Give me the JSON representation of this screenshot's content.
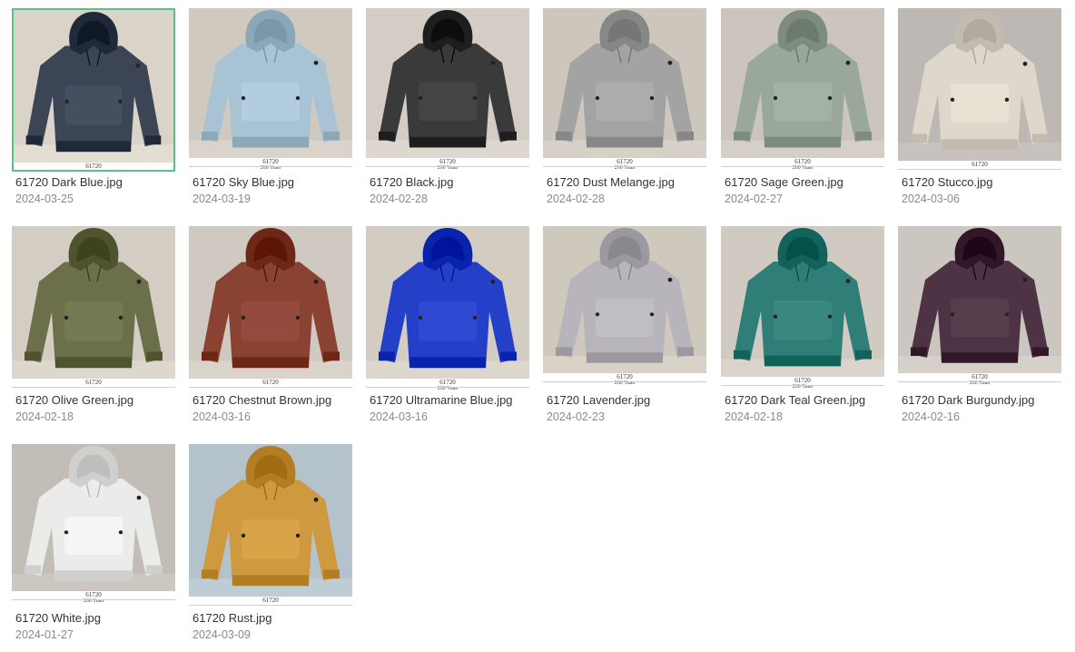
{
  "files": [
    {
      "name": "61720 Dark Blue.jpg",
      "date": "2024-03-25",
      "code": "61720",
      "price": "",
      "color": "#3b4556",
      "bg": "#d9d3c8",
      "selected": true
    },
    {
      "name": "61720 Sky Blue.jpg",
      "date": "2024-03-19",
      "code": "61720",
      "price": "260 Yuan",
      "color": "#a8c3d4",
      "bg": "#cfc9c0",
      "selected": false
    },
    {
      "name": "61720 Black.jpg",
      "date": "2024-02-28",
      "code": "61720",
      "price": "260 Yuan",
      "color": "#3a3a3b",
      "bg": "#d3cdc5",
      "selected": false
    },
    {
      "name": "61720 Dust Melange.jpg",
      "date": "2024-02-28",
      "code": "61720",
      "price": "260 Yuan",
      "color": "#a2a3a2",
      "bg": "#cdc6bd",
      "selected": false
    },
    {
      "name": "61720 Sage Green.jpg",
      "date": "2024-02-27",
      "code": "61720",
      "price": "260 Yuan",
      "color": "#9aa89a",
      "bg": "#cbc5bd",
      "selected": false
    },
    {
      "name": "61720 Stucco.jpg",
      "date": "2024-03-06",
      "code": "61720",
      "price": "",
      "color": "#ddd8cb",
      "bg": "#bdb8b3",
      "selected": false
    },
    {
      "name": "61720 Olive Green.jpg",
      "date": "2024-02-18",
      "code": "61720",
      "price": "",
      "color": "#6b6f4a",
      "bg": "#d3cdc4",
      "selected": false
    },
    {
      "name": "61720 Chestnut Brown.jpg",
      "date": "2024-03-16",
      "code": "61720",
      "price": "",
      "color": "#8a4233",
      "bg": "#cfc9c1",
      "selected": false
    },
    {
      "name": "61720 Ultramarine Blue.jpg",
      "date": "2024-03-16",
      "code": "61720",
      "price": "260 Yuan",
      "color": "#2440c8",
      "bg": "#d2ccc3",
      "selected": false
    },
    {
      "name": "61720 Lavender.jpg",
      "date": "2024-02-23",
      "code": "61720",
      "price": "260 Yuan",
      "color": "#b7b4bb",
      "bg": "#cfc8bc",
      "selected": false
    },
    {
      "name": "61720 Dark Teal Green.jpg",
      "date": "2024-02-18",
      "code": "61720",
      "price": "260 Yuan",
      "color": "#2f7f78",
      "bg": "#d0cac2",
      "selected": false
    },
    {
      "name": "61720 Dark Burgundy.jpg",
      "date": "2024-02-16",
      "code": "61720",
      "price": "260 Yuan",
      "color": "#4e3344",
      "bg": "#cbc6bf",
      "selected": false
    },
    {
      "name": "61720 White.jpg",
      "date": "2024-01-27",
      "code": "61720",
      "price": "260 Yuan",
      "color": "#ebebea",
      "bg": "#c2bdb7",
      "selected": false
    },
    {
      "name": "61720 Rust.jpg",
      "date": "2024-03-09",
      "code": "61720",
      "price": "",
      "color": "#cf9a3f",
      "bg": "#b3c2cb",
      "selected": false
    }
  ]
}
